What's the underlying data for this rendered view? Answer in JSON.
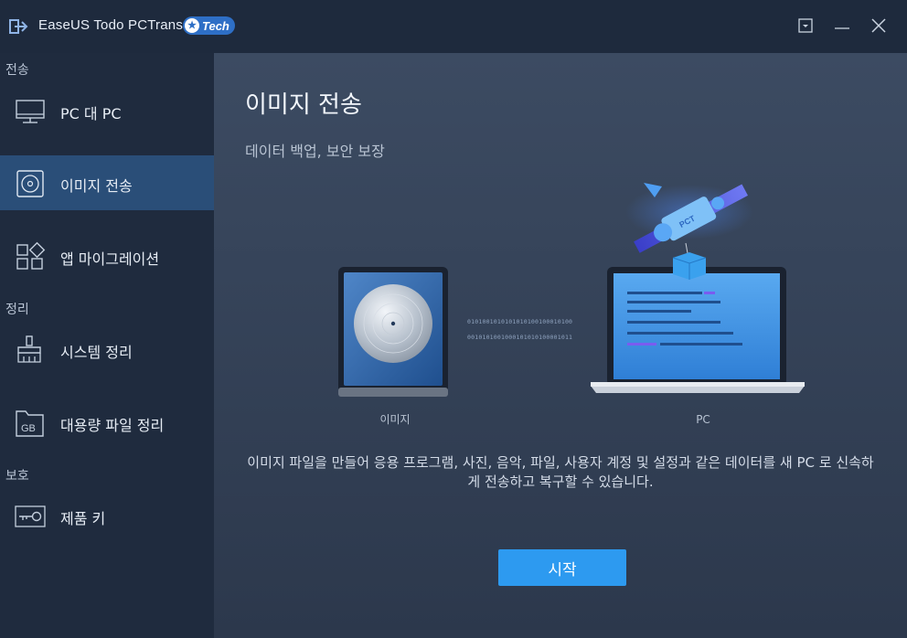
{
  "window": {
    "title": "EaseUS Todo PCTrans",
    "badge": "Tech"
  },
  "sidebar": {
    "sections": [
      {
        "label": "전송"
      },
      {
        "label": "정리"
      },
      {
        "label": "보호"
      }
    ],
    "items": [
      {
        "label": "PC 대 PC",
        "icon": "monitor-icon"
      },
      {
        "label": "이미지 전송",
        "icon": "disc-icon",
        "active": true
      },
      {
        "label": "앱 마이그레이션",
        "icon": "apps-icon"
      },
      {
        "label": "시스템 정리",
        "icon": "broom-icon"
      },
      {
        "label": "대용량 파일 정리",
        "icon": "gb-folder-icon"
      },
      {
        "label": "제품 키",
        "icon": "key-icon"
      }
    ]
  },
  "main": {
    "title": "이미지 전송",
    "subtitle": "데이터 백업, 보안 보장",
    "illustration": {
      "left_label": "이미지",
      "right_label": "PC",
      "binary_line1": "0101001010101010100100010100",
      "binary_line2": "0010101001000101010100001011",
      "satellite_text": "PCT"
    },
    "description": "이미지 파일을 만들어 응용 프로그램, 사진, 음악, 파일, 사용자 계정 및 설정과 같은 데이터를 새 PC 로 신속하게 전송하고 복구할 수 있습니다.",
    "start_label": "시작"
  },
  "colors": {
    "titlebar": "#1e2a3d",
    "sidebar": "#1f2b3e",
    "active_item": "#2a4e78",
    "accent": "#2d9af0"
  }
}
